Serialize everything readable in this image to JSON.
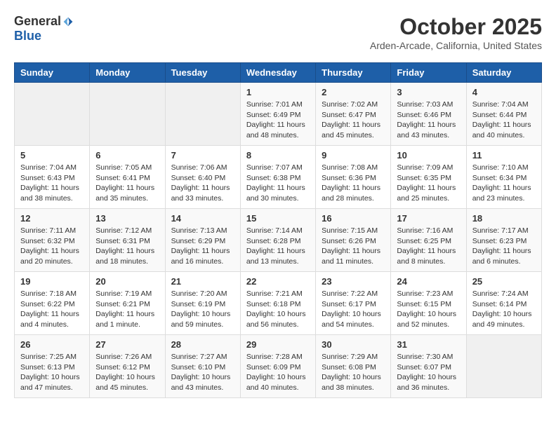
{
  "logo": {
    "general": "General",
    "blue": "Blue"
  },
  "title": "October 2025",
  "location": "Arden-Arcade, California, United States",
  "headers": [
    "Sunday",
    "Monday",
    "Tuesday",
    "Wednesday",
    "Thursday",
    "Friday",
    "Saturday"
  ],
  "weeks": [
    [
      {
        "day": "",
        "info": ""
      },
      {
        "day": "",
        "info": ""
      },
      {
        "day": "",
        "info": ""
      },
      {
        "day": "1",
        "info": "Sunrise: 7:01 AM\nSunset: 6:49 PM\nDaylight: 11 hours\nand 48 minutes."
      },
      {
        "day": "2",
        "info": "Sunrise: 7:02 AM\nSunset: 6:47 PM\nDaylight: 11 hours\nand 45 minutes."
      },
      {
        "day": "3",
        "info": "Sunrise: 7:03 AM\nSunset: 6:46 PM\nDaylight: 11 hours\nand 43 minutes."
      },
      {
        "day": "4",
        "info": "Sunrise: 7:04 AM\nSunset: 6:44 PM\nDaylight: 11 hours\nand 40 minutes."
      }
    ],
    [
      {
        "day": "5",
        "info": "Sunrise: 7:04 AM\nSunset: 6:43 PM\nDaylight: 11 hours\nand 38 minutes."
      },
      {
        "day": "6",
        "info": "Sunrise: 7:05 AM\nSunset: 6:41 PM\nDaylight: 11 hours\nand 35 minutes."
      },
      {
        "day": "7",
        "info": "Sunrise: 7:06 AM\nSunset: 6:40 PM\nDaylight: 11 hours\nand 33 minutes."
      },
      {
        "day": "8",
        "info": "Sunrise: 7:07 AM\nSunset: 6:38 PM\nDaylight: 11 hours\nand 30 minutes."
      },
      {
        "day": "9",
        "info": "Sunrise: 7:08 AM\nSunset: 6:36 PM\nDaylight: 11 hours\nand 28 minutes."
      },
      {
        "day": "10",
        "info": "Sunrise: 7:09 AM\nSunset: 6:35 PM\nDaylight: 11 hours\nand 25 minutes."
      },
      {
        "day": "11",
        "info": "Sunrise: 7:10 AM\nSunset: 6:34 PM\nDaylight: 11 hours\nand 23 minutes."
      }
    ],
    [
      {
        "day": "12",
        "info": "Sunrise: 7:11 AM\nSunset: 6:32 PM\nDaylight: 11 hours\nand 20 minutes."
      },
      {
        "day": "13",
        "info": "Sunrise: 7:12 AM\nSunset: 6:31 PM\nDaylight: 11 hours\nand 18 minutes."
      },
      {
        "day": "14",
        "info": "Sunrise: 7:13 AM\nSunset: 6:29 PM\nDaylight: 11 hours\nand 16 minutes."
      },
      {
        "day": "15",
        "info": "Sunrise: 7:14 AM\nSunset: 6:28 PM\nDaylight: 11 hours\nand 13 minutes."
      },
      {
        "day": "16",
        "info": "Sunrise: 7:15 AM\nSunset: 6:26 PM\nDaylight: 11 hours\nand 11 minutes."
      },
      {
        "day": "17",
        "info": "Sunrise: 7:16 AM\nSunset: 6:25 PM\nDaylight: 11 hours\nand 8 minutes."
      },
      {
        "day": "18",
        "info": "Sunrise: 7:17 AM\nSunset: 6:23 PM\nDaylight: 11 hours\nand 6 minutes."
      }
    ],
    [
      {
        "day": "19",
        "info": "Sunrise: 7:18 AM\nSunset: 6:22 PM\nDaylight: 11 hours\nand 4 minutes."
      },
      {
        "day": "20",
        "info": "Sunrise: 7:19 AM\nSunset: 6:21 PM\nDaylight: 11 hours\nand 1 minute."
      },
      {
        "day": "21",
        "info": "Sunrise: 7:20 AM\nSunset: 6:19 PM\nDaylight: 10 hours\nand 59 minutes."
      },
      {
        "day": "22",
        "info": "Sunrise: 7:21 AM\nSunset: 6:18 PM\nDaylight: 10 hours\nand 56 minutes."
      },
      {
        "day": "23",
        "info": "Sunrise: 7:22 AM\nSunset: 6:17 PM\nDaylight: 10 hours\nand 54 minutes."
      },
      {
        "day": "24",
        "info": "Sunrise: 7:23 AM\nSunset: 6:15 PM\nDaylight: 10 hours\nand 52 minutes."
      },
      {
        "day": "25",
        "info": "Sunrise: 7:24 AM\nSunset: 6:14 PM\nDaylight: 10 hours\nand 49 minutes."
      }
    ],
    [
      {
        "day": "26",
        "info": "Sunrise: 7:25 AM\nSunset: 6:13 PM\nDaylight: 10 hours\nand 47 minutes."
      },
      {
        "day": "27",
        "info": "Sunrise: 7:26 AM\nSunset: 6:12 PM\nDaylight: 10 hours\nand 45 minutes."
      },
      {
        "day": "28",
        "info": "Sunrise: 7:27 AM\nSunset: 6:10 PM\nDaylight: 10 hours\nand 43 minutes."
      },
      {
        "day": "29",
        "info": "Sunrise: 7:28 AM\nSunset: 6:09 PM\nDaylight: 10 hours\nand 40 minutes."
      },
      {
        "day": "30",
        "info": "Sunrise: 7:29 AM\nSunset: 6:08 PM\nDaylight: 10 hours\nand 38 minutes."
      },
      {
        "day": "31",
        "info": "Sunrise: 7:30 AM\nSunset: 6:07 PM\nDaylight: 10 hours\nand 36 minutes."
      },
      {
        "day": "",
        "info": ""
      }
    ]
  ]
}
